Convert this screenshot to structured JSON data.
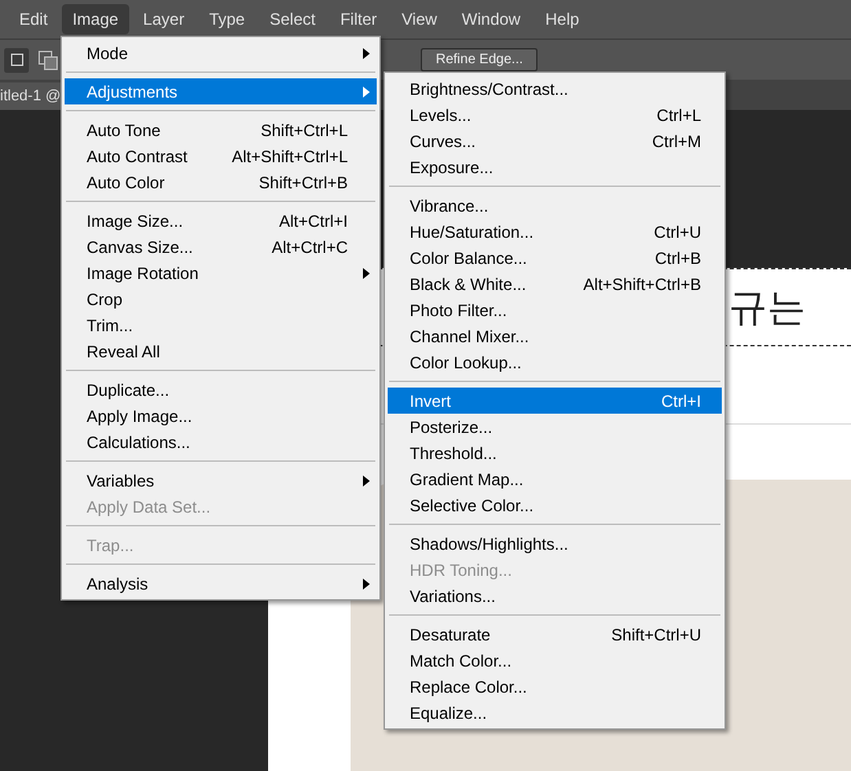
{
  "menubar": [
    {
      "label": "Edit",
      "selected": false
    },
    {
      "label": "Image",
      "selected": true
    },
    {
      "label": "Layer",
      "selected": false
    },
    {
      "label": "Type",
      "selected": false
    },
    {
      "label": "Select",
      "selected": false
    },
    {
      "label": "Filter",
      "selected": false
    },
    {
      "label": "View",
      "selected": false
    },
    {
      "label": "Window",
      "selected": false
    },
    {
      "label": "Help",
      "selected": false
    }
  ],
  "options_bar": {
    "button": "Refine Edge..."
  },
  "document_tab": {
    "title": "itled-1 @"
  },
  "document": {
    "heading": "규는"
  },
  "image_menu": [
    [
      {
        "label": "Mode",
        "submenu": true,
        "disabled": false,
        "selected": false
      }
    ],
    [
      {
        "label": "Adjustments",
        "submenu": true,
        "disabled": false,
        "selected": true
      }
    ],
    [
      {
        "label": "Auto Tone",
        "shortcut": "Shift+Ctrl+L",
        "submenu": false,
        "disabled": false,
        "selected": false
      },
      {
        "label": "Auto Contrast",
        "shortcut": "Alt+Shift+Ctrl+L",
        "submenu": false,
        "disabled": false,
        "selected": false
      },
      {
        "label": "Auto Color",
        "shortcut": "Shift+Ctrl+B",
        "submenu": false,
        "disabled": false,
        "selected": false
      }
    ],
    [
      {
        "label": "Image Size...",
        "shortcut": "Alt+Ctrl+I",
        "submenu": false,
        "disabled": false,
        "selected": false
      },
      {
        "label": "Canvas Size...",
        "shortcut": "Alt+Ctrl+C",
        "submenu": false,
        "disabled": false,
        "selected": false
      },
      {
        "label": "Image Rotation",
        "submenu": true,
        "disabled": false,
        "selected": false
      },
      {
        "label": "Crop",
        "submenu": false,
        "disabled": false,
        "selected": false
      },
      {
        "label": "Trim...",
        "submenu": false,
        "disabled": false,
        "selected": false
      },
      {
        "label": "Reveal All",
        "submenu": false,
        "disabled": false,
        "selected": false
      }
    ],
    [
      {
        "label": "Duplicate...",
        "submenu": false,
        "disabled": false,
        "selected": false
      },
      {
        "label": "Apply Image...",
        "submenu": false,
        "disabled": false,
        "selected": false
      },
      {
        "label": "Calculations...",
        "submenu": false,
        "disabled": false,
        "selected": false
      }
    ],
    [
      {
        "label": "Variables",
        "submenu": true,
        "disabled": false,
        "selected": false
      },
      {
        "label": "Apply Data Set...",
        "submenu": false,
        "disabled": true,
        "selected": false
      }
    ],
    [
      {
        "label": "Trap...",
        "submenu": false,
        "disabled": true,
        "selected": false
      }
    ],
    [
      {
        "label": "Analysis",
        "submenu": true,
        "disabled": false,
        "selected": false
      }
    ]
  ],
  "adjustments_menu": [
    [
      {
        "label": "Brightness/Contrast...",
        "disabled": false,
        "selected": false
      },
      {
        "label": "Levels...",
        "shortcut": "Ctrl+L",
        "disabled": false,
        "selected": false
      },
      {
        "label": "Curves...",
        "shortcut": "Ctrl+M",
        "disabled": false,
        "selected": false
      },
      {
        "label": "Exposure...",
        "disabled": false,
        "selected": false
      }
    ],
    [
      {
        "label": "Vibrance...",
        "disabled": false,
        "selected": false
      },
      {
        "label": "Hue/Saturation...",
        "shortcut": "Ctrl+U",
        "disabled": false,
        "selected": false
      },
      {
        "label": "Color Balance...",
        "shortcut": "Ctrl+B",
        "disabled": false,
        "selected": false
      },
      {
        "label": "Black & White...",
        "shortcut": "Alt+Shift+Ctrl+B",
        "disabled": false,
        "selected": false
      },
      {
        "label": "Photo Filter...",
        "disabled": false,
        "selected": false
      },
      {
        "label": "Channel Mixer...",
        "disabled": false,
        "selected": false
      },
      {
        "label": "Color Lookup...",
        "disabled": false,
        "selected": false
      }
    ],
    [
      {
        "label": "Invert",
        "shortcut": "Ctrl+I",
        "disabled": false,
        "selected": true
      },
      {
        "label": "Posterize...",
        "disabled": false,
        "selected": false
      },
      {
        "label": "Threshold...",
        "disabled": false,
        "selected": false
      },
      {
        "label": "Gradient Map...",
        "disabled": false,
        "selected": false
      },
      {
        "label": "Selective Color...",
        "disabled": false,
        "selected": false
      }
    ],
    [
      {
        "label": "Shadows/Highlights...",
        "disabled": false,
        "selected": false
      },
      {
        "label": "HDR Toning...",
        "disabled": true,
        "selected": false
      },
      {
        "label": "Variations...",
        "disabled": false,
        "selected": false
      }
    ],
    [
      {
        "label": "Desaturate",
        "shortcut": "Shift+Ctrl+U",
        "disabled": false,
        "selected": false
      },
      {
        "label": "Match Color...",
        "disabled": false,
        "selected": false
      },
      {
        "label": "Replace Color...",
        "disabled": false,
        "selected": false
      },
      {
        "label": "Equalize...",
        "disabled": false,
        "selected": false
      }
    ]
  ]
}
